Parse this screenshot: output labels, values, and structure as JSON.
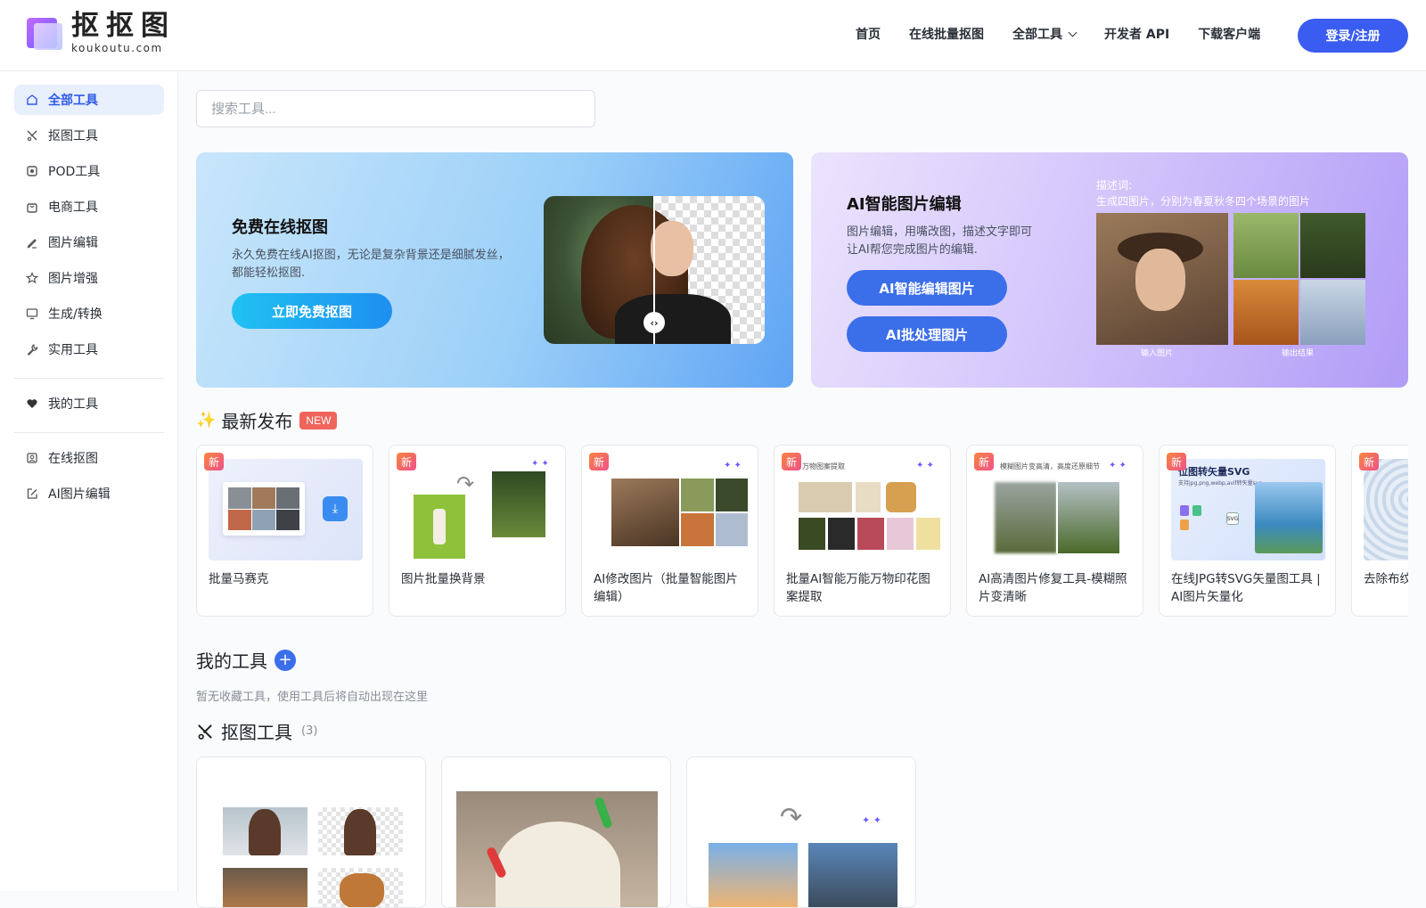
{
  "header": {
    "logo_cn": "抠抠图",
    "logo_en": "koukoutu.com",
    "nav": [
      "首页",
      "在线批量抠图",
      "全部工具",
      "开发者 API",
      "下载客户端"
    ],
    "login": "登录/注册"
  },
  "sidebar": {
    "items": [
      {
        "label": "全部工具",
        "icon": "home-icon"
      },
      {
        "label": "抠图工具",
        "icon": "scissors-icon"
      },
      {
        "label": "POD工具",
        "icon": "pod-icon"
      },
      {
        "label": "电商工具",
        "icon": "shopping-bag-icon"
      },
      {
        "label": "图片编辑",
        "icon": "pen-icon"
      },
      {
        "label": "图片增强",
        "icon": "star-icon"
      },
      {
        "label": "生成/转换",
        "icon": "monitor-icon"
      },
      {
        "label": "实用工具",
        "icon": "wrench-icon"
      }
    ],
    "favorites": {
      "label": "我的工具",
      "icon": "heart-icon"
    },
    "quick": [
      {
        "label": "在线抠图",
        "icon": "portrait-icon"
      },
      {
        "label": "AI图片编辑",
        "icon": "edit-icon"
      }
    ]
  },
  "search": {
    "placeholder": "搜索工具..."
  },
  "banner1": {
    "title": "免费在线抠图",
    "desc": "永久免费在线AI抠图，无论是复杂背景还是细腻发丝，都能轻松抠图.",
    "button": "立即免费抠图"
  },
  "banner2": {
    "title": "AI智能图片编辑",
    "desc": "图片编辑，用嘴改图，描述文字即可让AI帮您完成图片的编辑.",
    "button1": "AI智能编辑图片",
    "button2": "AI批处理图片",
    "caption_label": "描述词:",
    "caption_text": "生成四图片，分别为春夏秋冬四个场景的图片",
    "input_label": "输入图片",
    "output_label": "输出结果"
  },
  "latest": {
    "title": "最新发布",
    "badge": "NEW",
    "tag": "新",
    "cards": [
      {
        "title": "批量马赛克"
      },
      {
        "title": "图片批量换背景"
      },
      {
        "title": "AI修改图片（批量智能图片编辑）"
      },
      {
        "title": "批量AI智能万能万物印花图案提取"
      },
      {
        "title": "AI高清图片修复工具-模糊照片变清晰"
      },
      {
        "title": "在线JPG转SVG矢量图工具 | AI图片矢量化"
      },
      {
        "title": "去除布纹"
      }
    ],
    "thumb_texts": {
      "pattern": "万物图案提取",
      "restore": "模糊图片变高清，高度还原细节",
      "svg_title": "位图转矢量SVG",
      "svg_sub": "支持jpg,png,webp,avif转矢量svg",
      "svg_tag": "SVG"
    }
  },
  "mytools": {
    "title": "我的工具",
    "plus": "+",
    "hint": "暂无收藏工具，使用工具后将自动出现在这里"
  },
  "cutout": {
    "title": "抠图工具",
    "count": "(3)"
  }
}
